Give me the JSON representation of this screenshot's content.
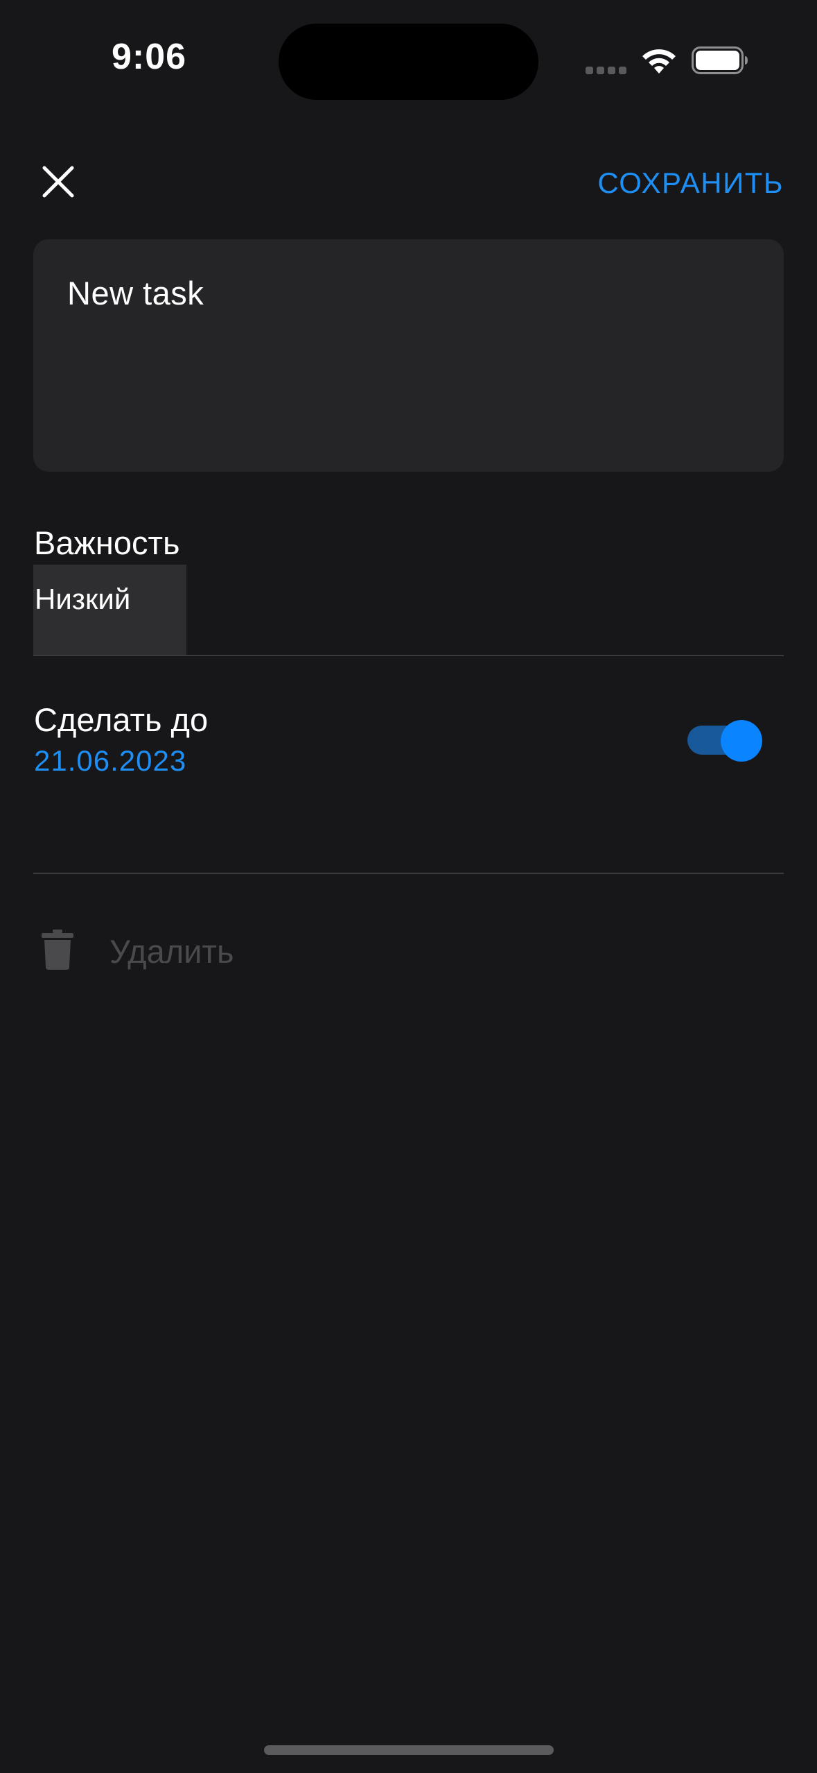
{
  "status_bar": {
    "time": "9:06"
  },
  "header": {
    "close_icon": "close-icon",
    "save_label": "СОХРАНИТЬ"
  },
  "task": {
    "text": "New task"
  },
  "importance": {
    "label": "Важность",
    "selected": "Низкий"
  },
  "deadline": {
    "label": "Сделать до",
    "date": "21.06.2023",
    "enabled": true
  },
  "delete": {
    "icon": "trash-icon",
    "label": "Удалить"
  },
  "colors": {
    "background": "#171719",
    "card": "#252527",
    "accent": "#1e8ff5",
    "toggle_thumb": "#0a84ff",
    "disabled_text": "#4a4a4c"
  }
}
